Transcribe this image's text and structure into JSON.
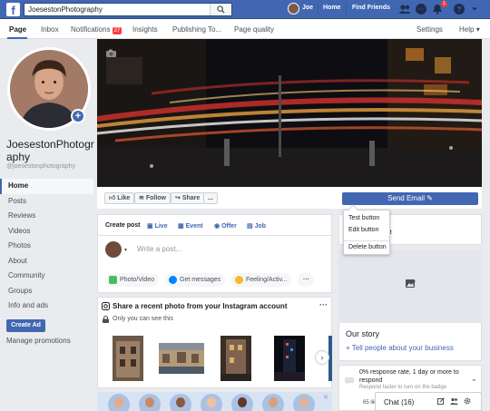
{
  "topbar": {
    "search_value": "JoesestonPhotography",
    "user_name": "Joe",
    "nav_home": "Home",
    "nav_find_friends": "Find Friends",
    "notification_count": "1",
    "colors": {
      "bar": "#4267b2",
      "badge": "#fa3e3e"
    }
  },
  "tabs": {
    "page": "Page",
    "inbox": "Inbox",
    "notifications": "Notifications",
    "notifications_count": "27",
    "insights": "Insights",
    "publishing": "Publishing To...",
    "page_quality": "Page quality",
    "settings": "Settings",
    "help": "Help"
  },
  "profile": {
    "name": "JoesestonPhotography",
    "handle": "@joesestonphotography"
  },
  "left_nav": {
    "items": [
      {
        "label": "Home",
        "active": true
      },
      {
        "label": "Posts"
      },
      {
        "label": "Reviews"
      },
      {
        "label": "Videos"
      },
      {
        "label": "Photos"
      },
      {
        "label": "About"
      },
      {
        "label": "Community"
      },
      {
        "label": "Groups"
      },
      {
        "label": "Info and ads"
      }
    ],
    "create_ad": "Create Ad",
    "manage_promotions": "Manage promotions"
  },
  "actions": {
    "like": "Like",
    "follow": "Follow",
    "share": "Share",
    "more": "...",
    "send_email": "Send Email"
  },
  "dropdown": {
    "items": [
      "Test button",
      "Edit button",
      "Delete button"
    ]
  },
  "composer": {
    "create_post": "Create post",
    "live": "Live",
    "event": "Event",
    "offer": "Offer",
    "job": "Job",
    "placeholder": "Write a post...",
    "photo_video": "Photo/Video",
    "get_messages": "Get messages",
    "feeling": "Feeling/Activ..."
  },
  "instagram": {
    "title": "Share a recent photo from your Instagram account",
    "subtitle": "Only you can see this"
  },
  "right": {
    "partial_text": "et",
    "our_story": "Our story",
    "tell_people": "+ Tell people about your business",
    "response_line": "0% response rate, 1 day or more to respond",
    "response_sub": "Respond faster to turn on the badge",
    "likes": "65 lik"
  },
  "chat": {
    "label": "Chat (16)"
  }
}
